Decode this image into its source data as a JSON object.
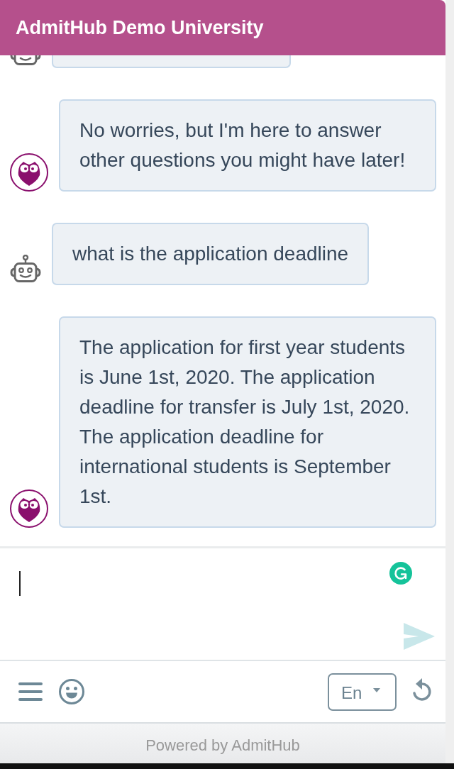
{
  "header": {
    "title": "AdmitHub Demo University"
  },
  "messages": [
    {
      "kind": "user"
    },
    {
      "kind": "bot",
      "text": "No worries, but I'm here to answer other questions you might have later!"
    },
    {
      "kind": "user",
      "text": "what is the application deadline"
    },
    {
      "kind": "bot",
      "text": "The application for first year students is June 1st, 2020. The application deadline for transfer is July 1st, 2020. The application deadline for international students is September 1st."
    }
  ],
  "composer": {
    "focused": true,
    "send_disabled": true
  },
  "toolbar": {
    "language": "En"
  },
  "footer": {
    "text": "Powered by AdmitHub"
  }
}
